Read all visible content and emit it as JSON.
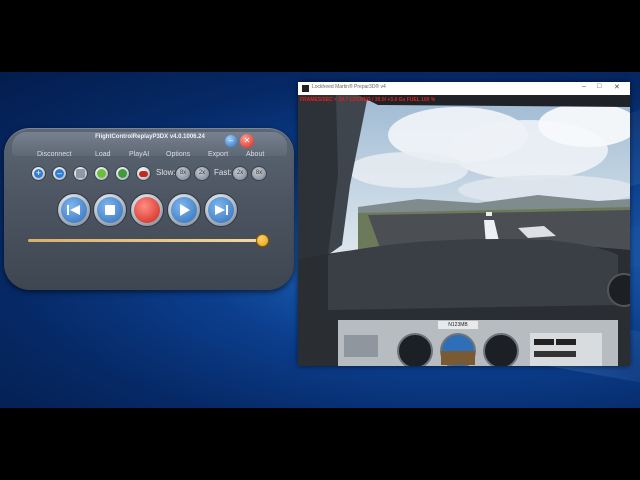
{
  "replay_app": {
    "title": "FlightControlReplayP3DX v4.0.1006.24",
    "menu": [
      "Disconnect",
      "Load",
      "PlayAI",
      "Options",
      "Export",
      "About"
    ],
    "slow_label": "Slow:",
    "fast_label": "Fast:",
    "slow_speeds": [
      "8x",
      "2x"
    ],
    "fast_speeds": [
      "2x",
      "8x"
    ],
    "playback_position": 0.97,
    "colors": {
      "accent": "#2b6fc2",
      "record": "#d4281c",
      "slider": "#e49a12"
    }
  },
  "sim_window": {
    "title": "Lockheed Martin® Prepar3D® v4",
    "frame_stats": "FRAMES/SEC = 29.7  LOCKED  /  30.0/  +3.0 Gs   FUEL 100 %",
    "window_controls": [
      "–",
      "□",
      "✕"
    ],
    "tail_number": "N123MB"
  }
}
